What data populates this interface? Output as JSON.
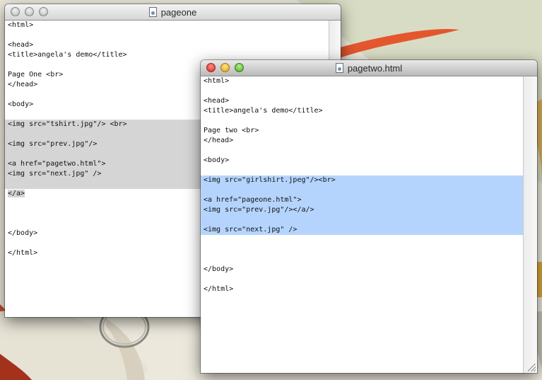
{
  "window_back": {
    "title": "pageone",
    "lines": [
      "<html>",
      "",
      "<head>",
      "<title>angela's demo</title>",
      "",
      "Page One <br>",
      "</head>",
      "",
      "<body>",
      "",
      "<img src=\"tshirt.jpg\"/> <br>",
      "",
      "<img src=\"prev.jpg\"/>",
      "",
      "<a href=\"pagetwo.html\">",
      "<img src=\"next.jpg\" />",
      "",
      "</a>",
      "",
      "",
      "",
      "</body>",
      "",
      "</html>"
    ],
    "selection_color": "#d5d5d5"
  },
  "window_front": {
    "title": "pagetwo.html",
    "lines": [
      "<html>",
      "",
      "<head>",
      "<title>angela's demo</title>",
      "",
      "Page two <br>",
      "</head>",
      "",
      "<body>",
      "",
      "<img src=\"girlshirt.jpeg\"/><br>",
      "",
      "<a href=\"pageone.html\">",
      "<img src=\"prev.jpg\"/></a/>",
      "",
      "<img src=\"next.jpg\" />",
      "",
      "",
      "",
      "</body>",
      "",
      "</html>"
    ],
    "selection_color": "#b5d4fd"
  },
  "colors": {
    "traffic_red": "#d8261c",
    "traffic_yellow": "#e0a112",
    "traffic_green": "#4aa428"
  },
  "icons": {
    "document": "document-icon",
    "close": "close-icon",
    "minimize": "minimize-icon",
    "zoom": "zoom-icon"
  }
}
